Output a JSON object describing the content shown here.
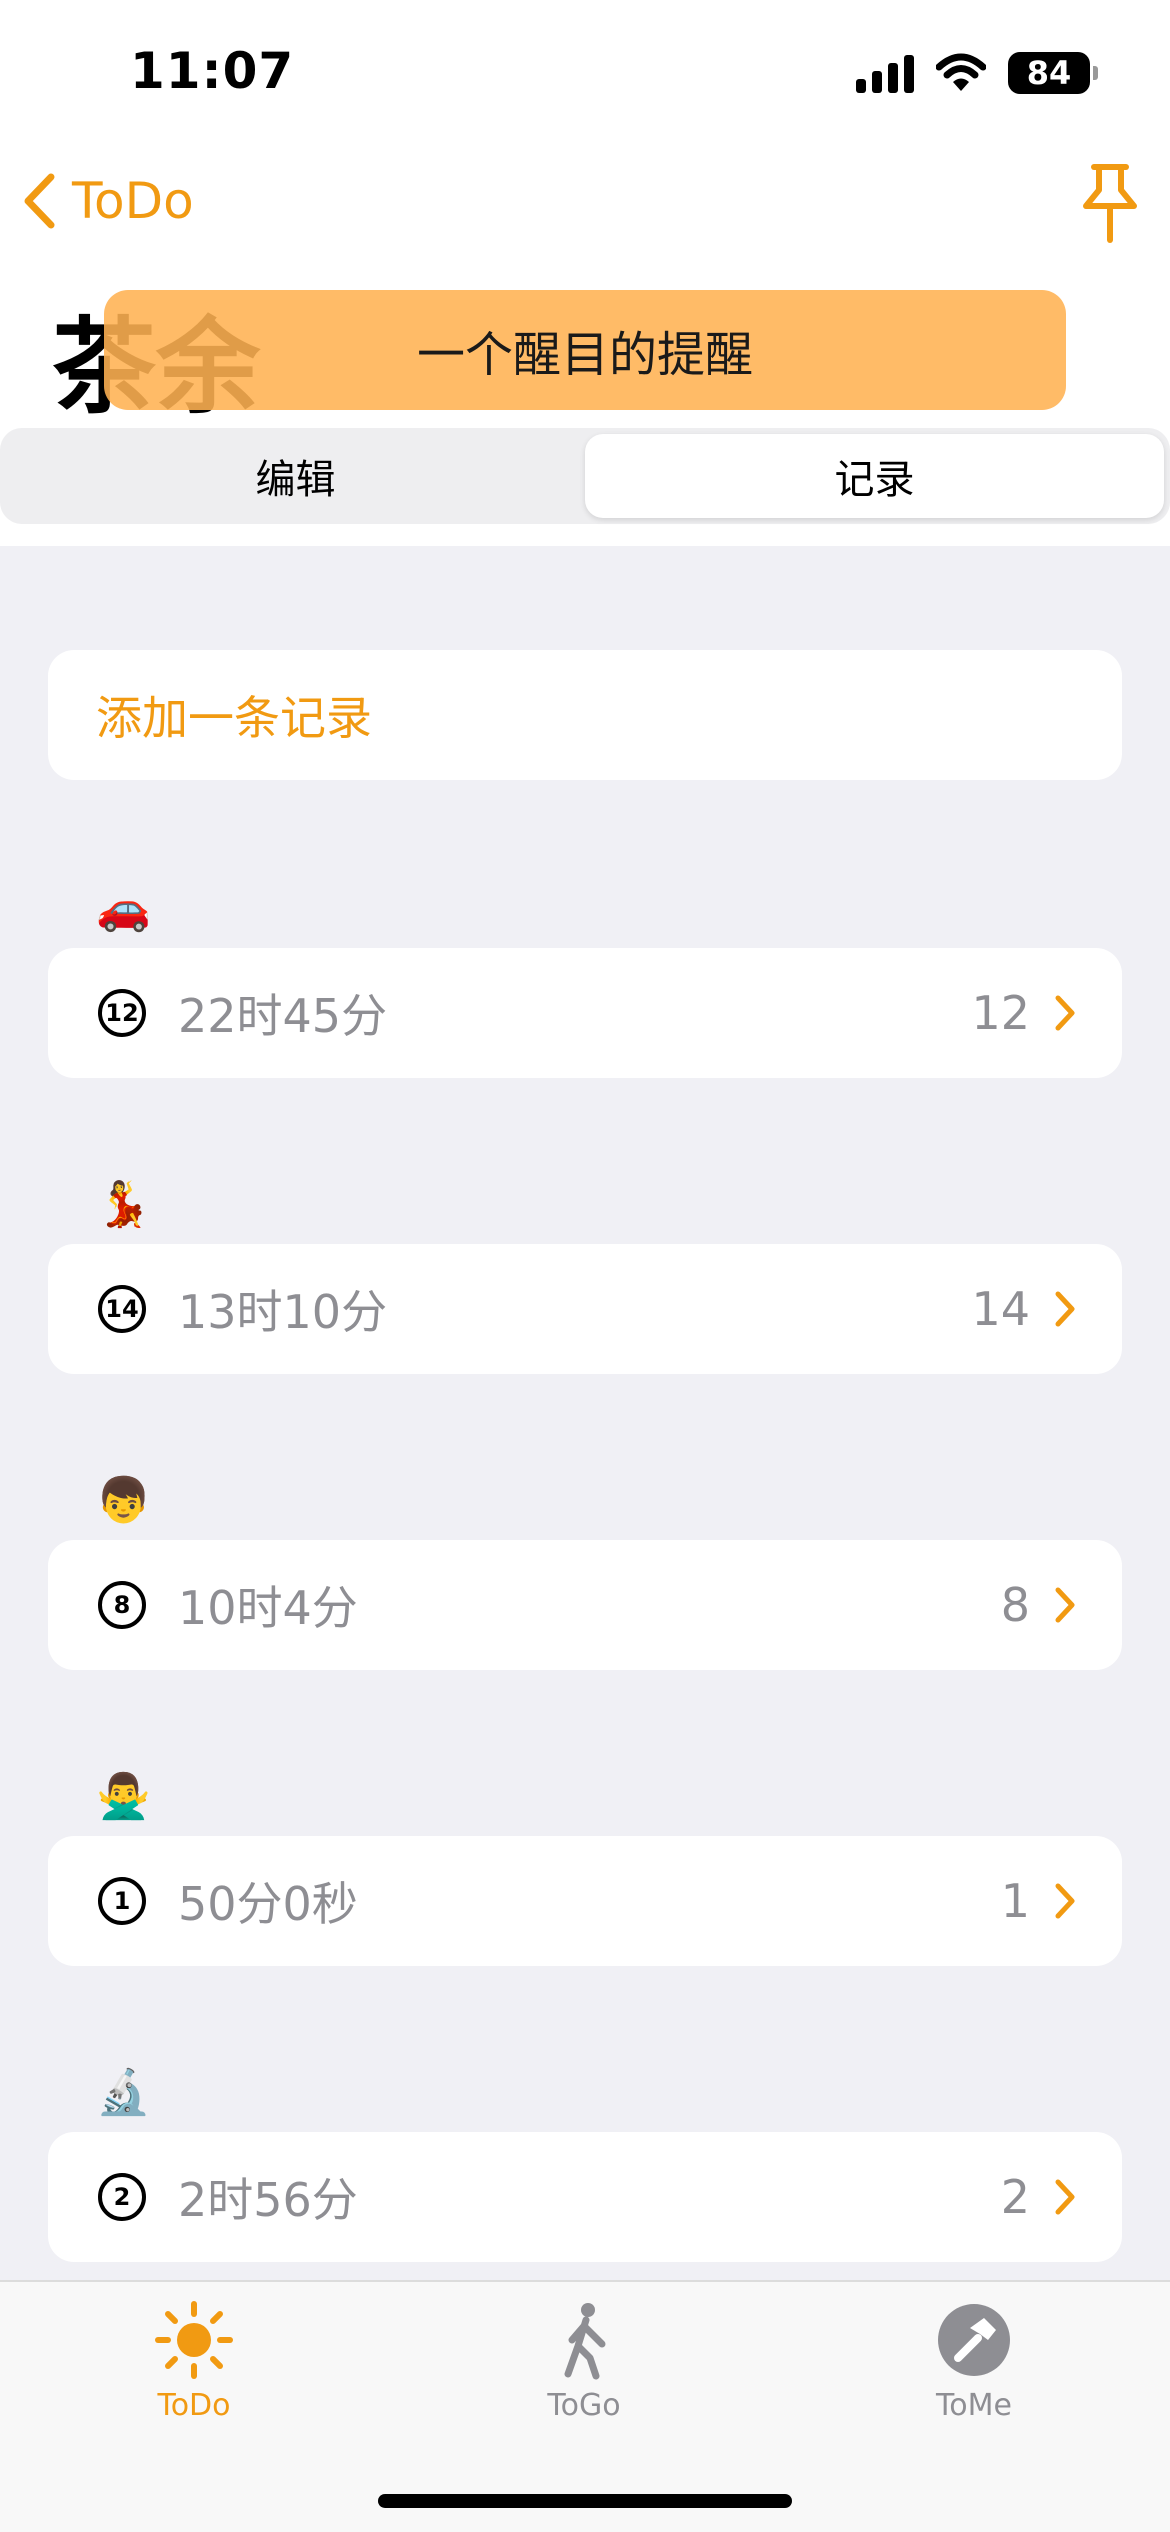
{
  "status_bar": {
    "time": "11:07",
    "battery": "84"
  },
  "nav": {
    "back_label": "ToDo"
  },
  "page": {
    "title": "茶余"
  },
  "banner": {
    "text": "一个醒目的提醒"
  },
  "segmented": {
    "options": [
      "编辑",
      "记录"
    ],
    "selected": "记录"
  },
  "add_record": {
    "label": "添加一条记录"
  },
  "records": [
    {
      "emoji": "🚗",
      "number": "12",
      "time": "22时45分",
      "count": "12"
    },
    {
      "emoji": "💃",
      "number": "14",
      "time": "13时10分",
      "count": "14"
    },
    {
      "emoji": "👦",
      "number": "8",
      "time": "10时4分",
      "count": "8"
    },
    {
      "emoji": "🙅‍♂️",
      "number": "1",
      "time": "50分0秒",
      "count": "1"
    },
    {
      "emoji": "🔬",
      "number": "2",
      "time": "2时56分",
      "count": "2"
    }
  ],
  "tabs": [
    {
      "label": "ToDo",
      "icon": "sun-icon",
      "active": true
    },
    {
      "label": "ToGo",
      "icon": "walking-person-icon",
      "active": false
    },
    {
      "label": "ToMe",
      "icon": "hammer-icon",
      "active": false
    }
  ],
  "colors": {
    "accent": "#f19a12",
    "banner": "#ffb252",
    "list_bg": "#f0f0f5",
    "secondary_text": "#8e8e93"
  }
}
